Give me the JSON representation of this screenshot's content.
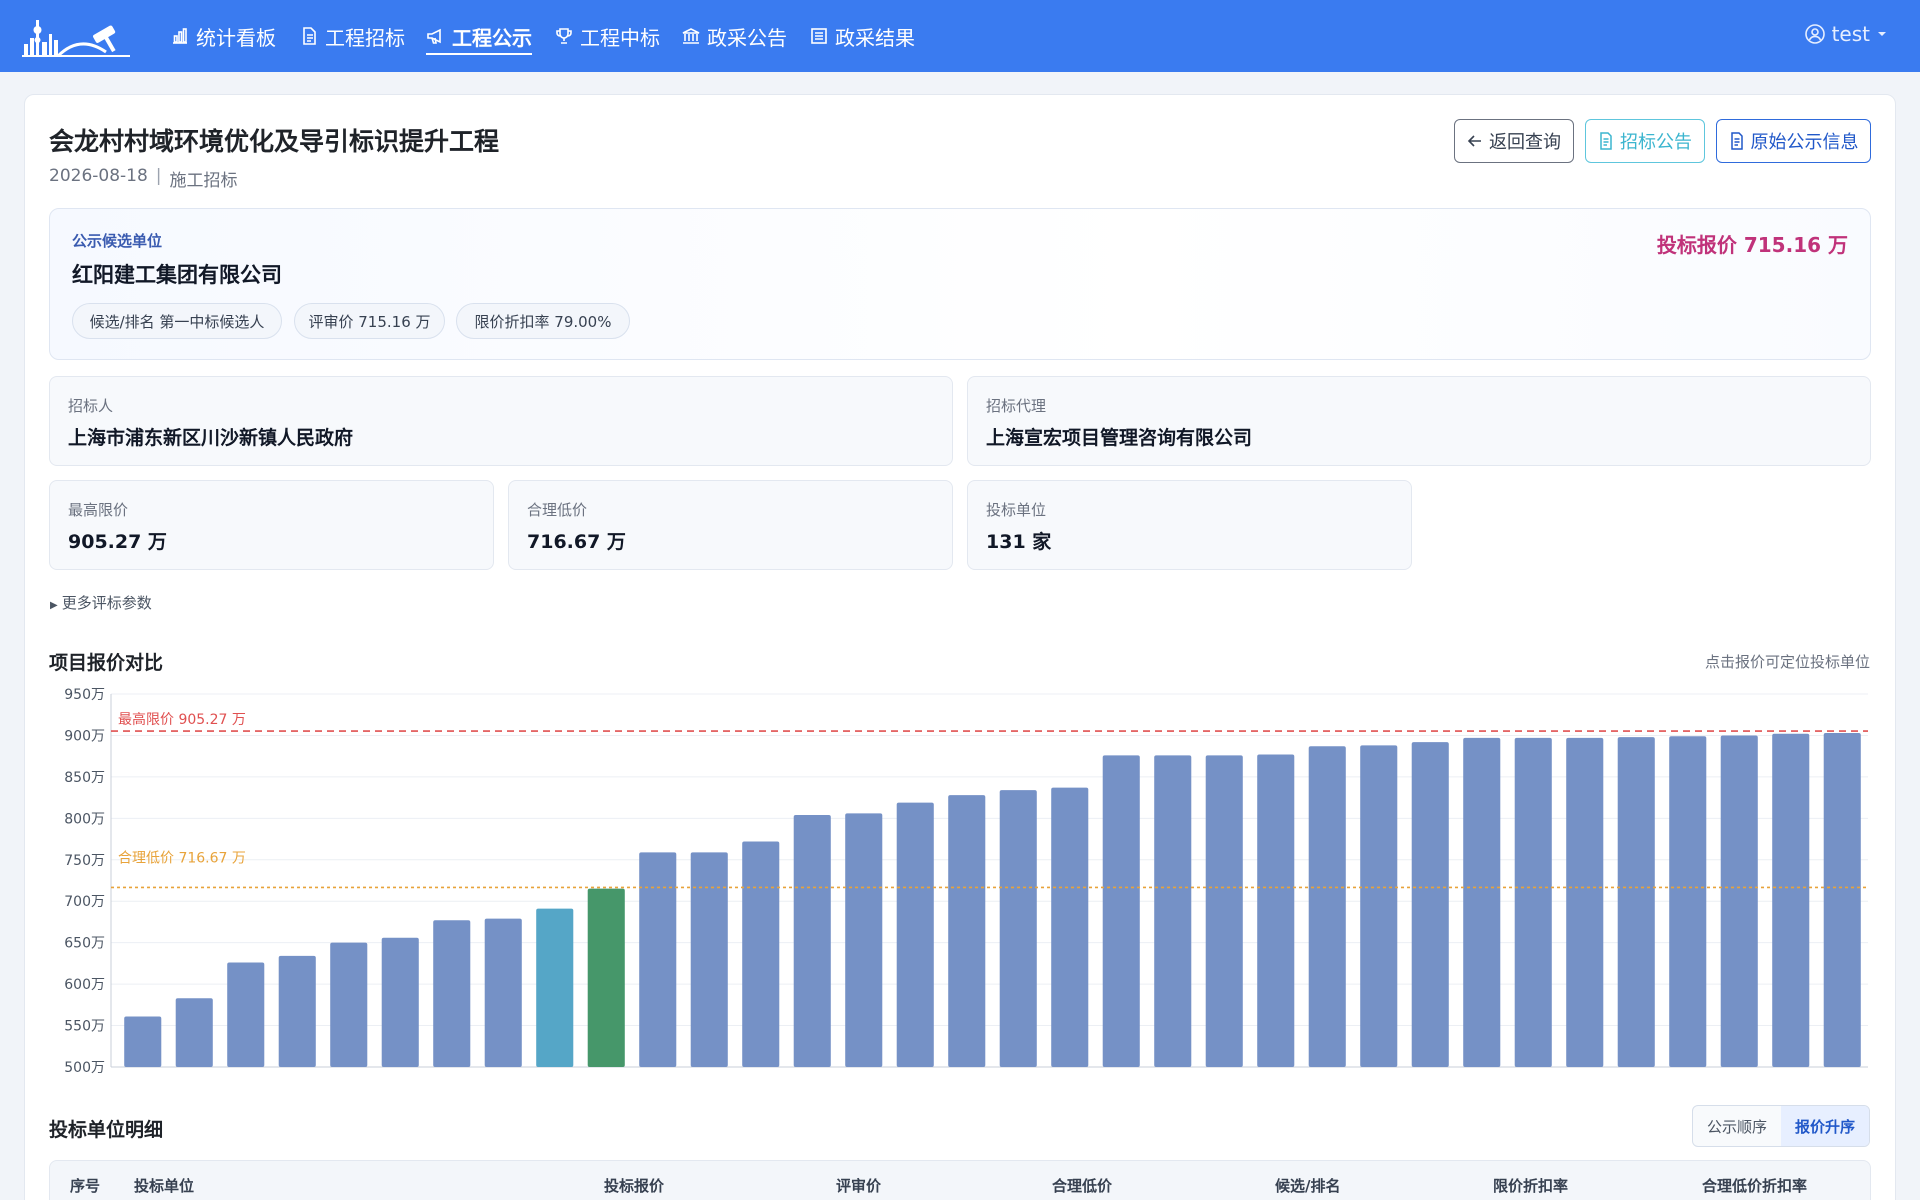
{
  "nav": {
    "items": [
      {
        "label": "统计看板",
        "icon": "bar-chart-icon",
        "active": false
      },
      {
        "label": "工程招标",
        "icon": "document-icon",
        "active": false
      },
      {
        "label": "工程公示",
        "icon": "megaphone-icon",
        "active": true
      },
      {
        "label": "工程中标",
        "icon": "trophy-icon",
        "active": false
      },
      {
        "label": "政采公告",
        "icon": "bank-icon",
        "active": false
      },
      {
        "label": "政采结果",
        "icon": "list-icon",
        "active": false
      }
    ],
    "user": "test"
  },
  "project": {
    "title": "会龙村村域环境优化及导引标识提升工程",
    "date": "2026-08-18",
    "type": "施工招标"
  },
  "buttons": {
    "back": "返回查询",
    "notice": "招标公告",
    "original": "原始公示信息"
  },
  "candidate": {
    "label": "公示候选单位",
    "name": "红阳建工集团有限公司",
    "bid": "投标报价 715.16 万",
    "chips": [
      "候选/排名 第一中标候选人",
      "评审价 715.16 万",
      "限价折扣率 79.00%"
    ]
  },
  "info": {
    "tenderer_label": "招标人",
    "tenderer": "上海市浦东新区川沙新镇人民政府",
    "agent_label": "招标代理",
    "agent": "上海宣宏项目管理咨询有限公司",
    "max_price_label": "最高限价",
    "max_price": "905.27 万",
    "reasonable_low_label": "合理低价",
    "reasonable_low": "716.67 万",
    "bidders_label": "投标单位",
    "bidders": "131 家"
  },
  "more_params": "更多评标参数",
  "chart_section": {
    "title": "项目报价对比",
    "hint": "点击报价可定位投标单位"
  },
  "chart_data": {
    "type": "bar",
    "ylim": [
      500,
      950
    ],
    "yticks": [
      500,
      550,
      600,
      650,
      700,
      750,
      800,
      850,
      900,
      950
    ],
    "ytick_suffix": "万",
    "values": [
      561,
      583,
      626,
      634,
      650,
      656,
      677,
      679,
      691,
      715.16,
      759,
      759,
      772,
      804,
      806,
      819,
      828,
      834,
      837,
      876,
      876,
      876,
      877,
      887,
      888,
      892,
      897,
      897,
      897,
      898,
      899,
      900,
      902,
      903
    ],
    "highlight": {
      "index": 9,
      "color": "#46976a"
    },
    "secondary_highlight": {
      "index": 8,
      "color": "#55a6c7"
    },
    "bar_color": "#7591c6",
    "ref_lines": [
      {
        "label": "最高限价 905.27 万",
        "value": 905.27,
        "color": "#e05050"
      },
      {
        "label": "合理低价 716.67 万",
        "value": 716.67,
        "color": "#e8a33a"
      }
    ]
  },
  "detail_section": {
    "title": "投标单位明细",
    "sort_options": [
      "公示顺序",
      "报价升序"
    ],
    "sort_active": 1,
    "columns": [
      "序号",
      "投标单位",
      "投标报价",
      "评审价",
      "合理低价",
      "候选/排名",
      "限价折扣率",
      "合理低价折扣率"
    ]
  }
}
